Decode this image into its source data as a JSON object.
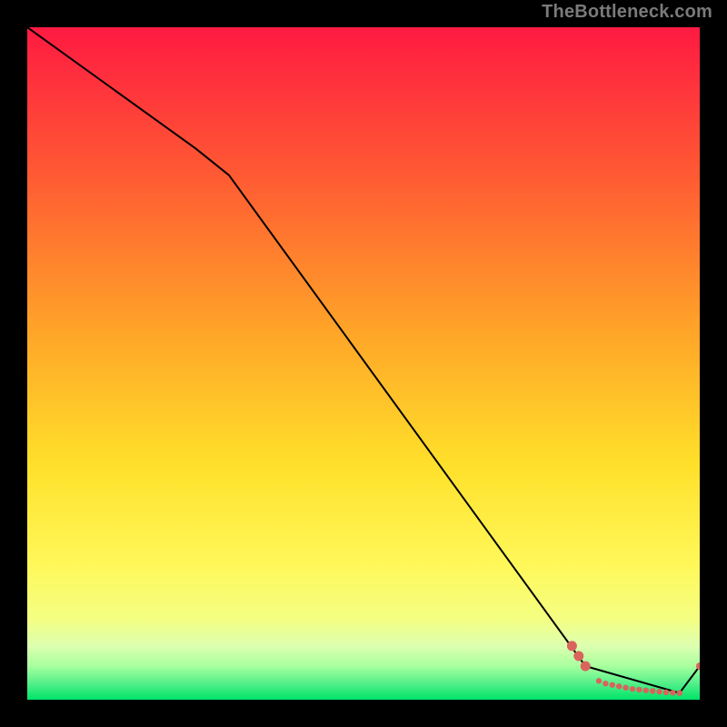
{
  "watermark": "TheBottleneck.com",
  "colors": {
    "background": "#000000",
    "watermark_text": "#7a7a7a",
    "line": "#000000",
    "marker": "#d9645b",
    "marker_edge": "#d9645b"
  },
  "chart_data": {
    "type": "line",
    "title": "",
    "xlabel": "",
    "ylabel": "",
    "xlim": [
      0,
      100
    ],
    "ylim": [
      0,
      100
    ],
    "grid": false,
    "legend": false,
    "background_gradient": {
      "top": "#ff1a42",
      "mid_upper": "#ff8a2a",
      "mid": "#ffe02a",
      "mid_lower": "#f2ff7a",
      "green_band_top": "#cfff9a",
      "green_band_bottom": "#00e36a"
    },
    "series": [
      {
        "name": "curve",
        "style": "line",
        "x": [
          0,
          25,
          30,
          83,
          97,
          100
        ],
        "y": [
          100,
          82,
          78,
          5,
          1,
          5
        ]
      },
      {
        "name": "highlight-points",
        "style": "scatter",
        "x": [
          81,
          82,
          83,
          85,
          86,
          87,
          88,
          89,
          90,
          91,
          92,
          93,
          94,
          95,
          96,
          97,
          100
        ],
        "y": [
          8,
          6.5,
          5,
          2.8,
          2.4,
          2.2,
          2.0,
          1.8,
          1.6,
          1.5,
          1.4,
          1.3,
          1.2,
          1.1,
          1.05,
          1,
          5
        ]
      }
    ]
  }
}
